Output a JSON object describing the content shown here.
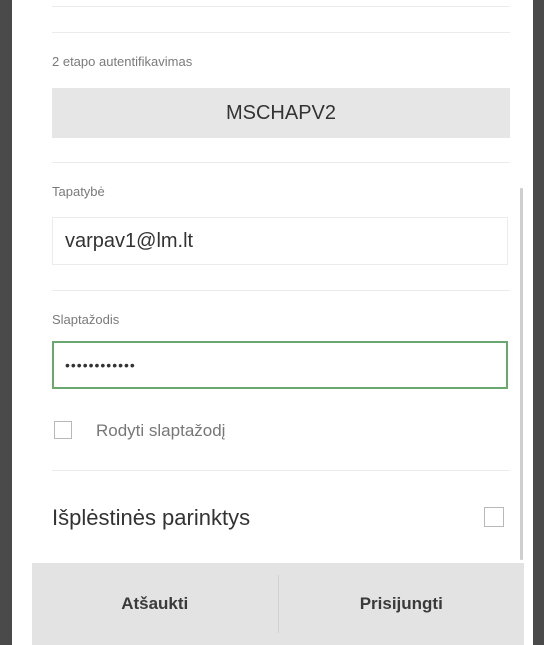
{
  "dialog": {
    "phase2": {
      "label": "2 etapo autentifikavimas",
      "value": "MSCHAPV2"
    },
    "identity": {
      "label": "Tapatybė",
      "value": "varpav1@lm.lt"
    },
    "password": {
      "label": "Slaptažodis",
      "masked_value": "••••••••••••"
    },
    "show_password": {
      "label": "Rodyti slaptažodį",
      "checked": false
    },
    "advanced": {
      "label": "Išplėstinės parinktys",
      "checked": false
    }
  },
  "buttons": {
    "cancel_label": "Atšaukti",
    "connect_label": "Prisijungti"
  },
  "colors": {
    "focus_border": "#6aa870",
    "button_bar": "#e3e3e3",
    "select_bg": "#e6e6e6"
  }
}
